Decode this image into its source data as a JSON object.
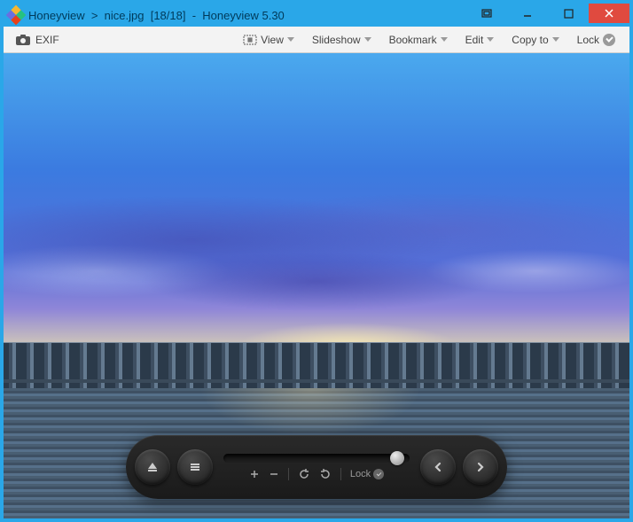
{
  "titlebar": {
    "app": "Honeyview",
    "sep": ">",
    "file": "nice.jpg",
    "index": "[18/18]",
    "dash": "-",
    "appver": "Honeyview 5.30"
  },
  "toolbar": {
    "exif": "EXIF",
    "view": "View",
    "slideshow": "Slideshow",
    "bookmark": "Bookmark",
    "edit": "Edit",
    "copyto": "Copy to",
    "lock": "Lock"
  },
  "controls": {
    "lock": "Lock"
  }
}
